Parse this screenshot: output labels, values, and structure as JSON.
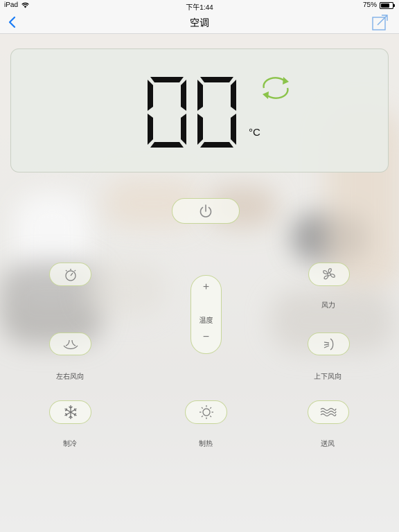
{
  "status_bar": {
    "device": "iPad",
    "time": "下午1:44",
    "battery": "75%"
  },
  "nav": {
    "title": "空调",
    "back_icon": "chevron-left-icon",
    "share_icon": "share-external-icon"
  },
  "display": {
    "temperature": "00",
    "unit": "°C",
    "mode_icon": "cycle-arrows-icon",
    "accent_color": "#8bc34a"
  },
  "controls": {
    "power_icon": "power-icon",
    "timer_icon": "timer-icon",
    "fan_speed_label": "风力",
    "fan_speed_icon": "fan-icon",
    "temp_label": "温度",
    "temp_plus": "+",
    "temp_minus": "−",
    "swing_lr_label": "左右风向",
    "swing_lr_icon": "swing-left-right-icon",
    "swing_ud_label": "上下风向",
    "swing_ud_icon": "swing-up-down-icon",
    "cool_label": "制冷",
    "cool_icon": "snowflake-icon",
    "heat_label": "制热",
    "heat_icon": "sun-icon",
    "fan_mode_label": "送风",
    "fan_mode_icon": "wind-waves-icon"
  },
  "colors": {
    "button_border": "#c7d69a",
    "nav_accent": "#1a7cf5"
  }
}
